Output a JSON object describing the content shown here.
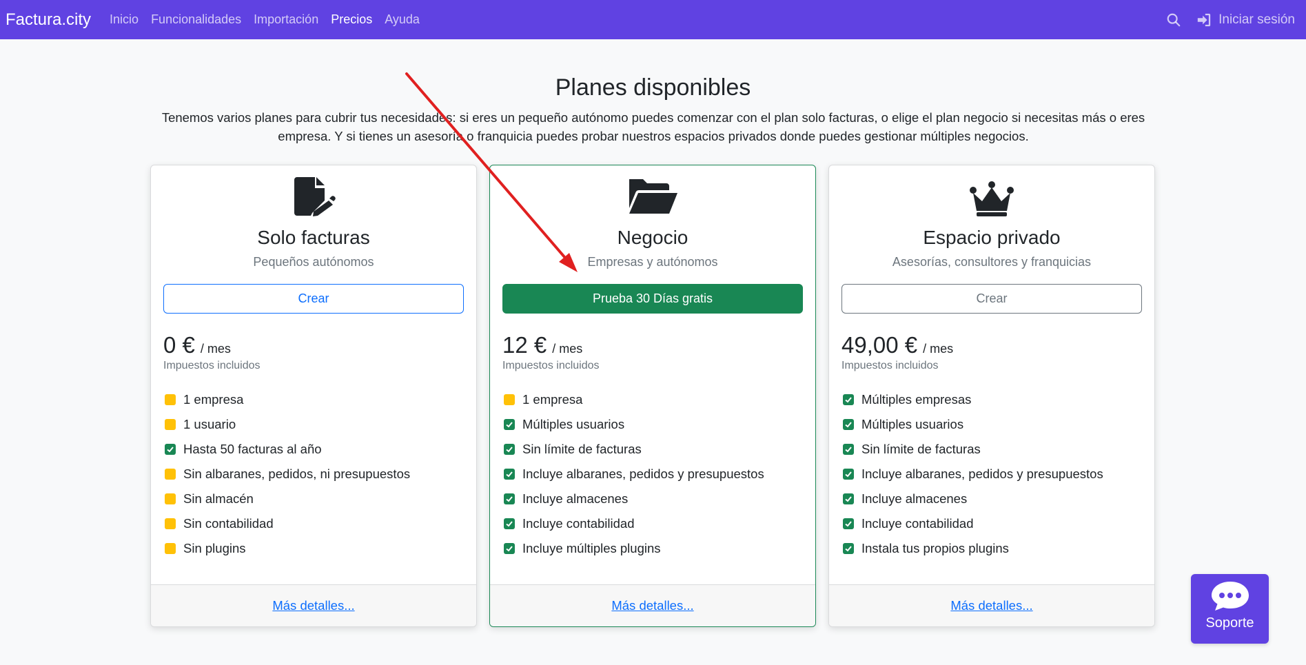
{
  "navbar": {
    "brand": "Factura.city",
    "links": [
      {
        "label": "Inicio",
        "active": false
      },
      {
        "label": "Funcionalidades",
        "active": false
      },
      {
        "label": "Importación",
        "active": false
      },
      {
        "label": "Precios",
        "active": true
      },
      {
        "label": "Ayuda",
        "active": false
      }
    ],
    "search_icon": "search-icon",
    "login_label": "Iniciar sesión",
    "login_icon": "sign-in-icon",
    "background": "#6042e2"
  },
  "hero": {
    "title": "Planes disponibles",
    "intro": "Tenemos varios planes para cubrir tus necesidades: si eres un pequeño autónomo puedes comenzar con el plan solo facturas, o elige el plan negocio si necesitas más o eres empresa. Y si tienes un asesoría o franquicia puedes probar nuestros espacios privados donde puedes gestionar múltiples negocios."
  },
  "plans": [
    {
      "icon": "file-edit-icon",
      "title": "Solo facturas",
      "subtitle": "Pequeños autónomos",
      "button_label": "Crear",
      "button_style": "primary-outline",
      "price": "0 €",
      "period": "/ mes",
      "tax_note": "Impuestos incluidos",
      "features": [
        {
          "text": "1 empresa",
          "status": "warn"
        },
        {
          "text": "1 usuario",
          "status": "warn"
        },
        {
          "text": "Hasta 50 facturas al año",
          "status": "check"
        },
        {
          "text": "Sin albaranes, pedidos, ni presupuestos",
          "status": "warn"
        },
        {
          "text": "Sin almacén",
          "status": "warn"
        },
        {
          "text": "Sin contabilidad",
          "status": "warn"
        },
        {
          "text": "Sin plugins",
          "status": "warn"
        }
      ],
      "footer_link": "Más detalles..."
    },
    {
      "icon": "folder-open-icon",
      "title": "Negocio",
      "subtitle": "Empresas y autónomos",
      "button_label": "Prueba 30 Días gratis",
      "button_style": "success",
      "price": "12 €",
      "period": "/ mes",
      "tax_note": "Impuestos incluidos",
      "features": [
        {
          "text": "1 empresa",
          "status": "warn"
        },
        {
          "text": "Múltiples usuarios",
          "status": "check"
        },
        {
          "text": "Sin límite de facturas",
          "status": "check"
        },
        {
          "text": "Incluye albaranes, pedidos y presupuestos",
          "status": "check"
        },
        {
          "text": "Incluye almacenes",
          "status": "check"
        },
        {
          "text": "Incluye contabilidad",
          "status": "check"
        },
        {
          "text": "Incluye múltiples plugins",
          "status": "check"
        }
      ],
      "footer_link": "Más detalles..."
    },
    {
      "icon": "crown-icon",
      "title": "Espacio privado",
      "subtitle": "Asesorías, consultores y franquicias",
      "button_label": "Crear",
      "button_style": "secondary-outline",
      "price": "49,00 €",
      "period": "/ mes",
      "tax_note": "Impuestos incluidos",
      "features": [
        {
          "text": "Múltiples empresas",
          "status": "check"
        },
        {
          "text": "Múltiples usuarios",
          "status": "check"
        },
        {
          "text": "Sin límite de facturas",
          "status": "check"
        },
        {
          "text": "Incluye albaranes, pedidos y presupuestos",
          "status": "check"
        },
        {
          "text": "Incluye almacenes",
          "status": "check"
        },
        {
          "text": "Incluye contabilidad",
          "status": "check"
        },
        {
          "text": "Instala tus propios plugins",
          "status": "check"
        }
      ],
      "footer_link": "Más detalles..."
    }
  ],
  "support": {
    "label": "Soporte",
    "icon": "chat-bubble-icon"
  },
  "annotation": {
    "type": "arrow",
    "color": "#e02020"
  },
  "colors": {
    "accent": "#6042e2",
    "success": "#198754",
    "warning": "#ffc107",
    "primary": "#0d6efd"
  }
}
